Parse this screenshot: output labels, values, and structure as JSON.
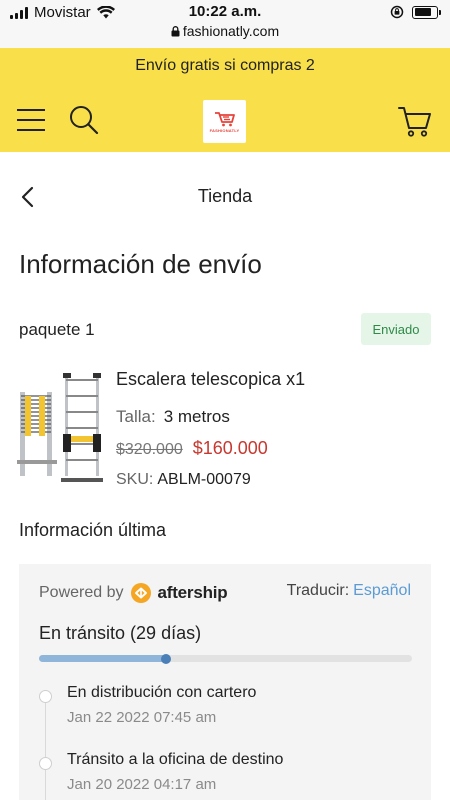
{
  "status_bar": {
    "carrier": "Movistar",
    "time": "10:22 a.m.",
    "url": "fashionatly.com",
    "battery_level": 0.78
  },
  "header": {
    "promo": "Envío gratis si compras 2",
    "logo_text": "FASHIONATLY",
    "icons": [
      "menu-icon",
      "search-icon",
      "cart-icon"
    ],
    "brand_color": "#f9e04b"
  },
  "nav": {
    "title": "Tienda"
  },
  "page": {
    "title": "Información de envío"
  },
  "package": {
    "label": "paquete 1",
    "status": "Enviado"
  },
  "product": {
    "name": "Escalera telescopica x1",
    "size_label": "Talla:",
    "size_value": "3 metros",
    "old_price": "$320.000",
    "new_price": "$160.000",
    "sku_label": "SKU:",
    "sku_value": "ABLM-00079"
  },
  "tracking": {
    "section_title": "Información última",
    "powered_by": "Powered by",
    "provider": "aftership",
    "translate_label": "Traducir:",
    "language": "Español",
    "status_title": "En tránsito (29 días)",
    "progress": 0.34,
    "events": [
      {
        "title": "En distribución con cartero",
        "date": "Jan 22 2022 07:45 am"
      },
      {
        "title": "Tránsito a la oficina de destino",
        "date": "Jan 20 2022 04:17 am"
      }
    ]
  }
}
